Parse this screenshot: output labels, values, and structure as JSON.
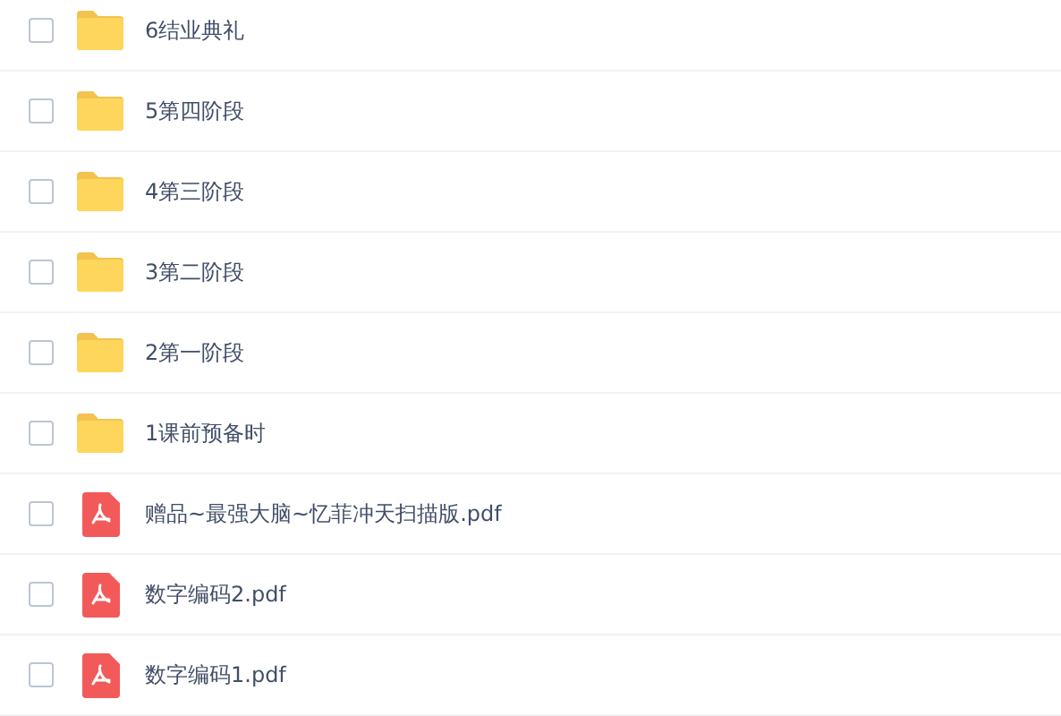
{
  "files": [
    {
      "kind": "folder",
      "name": "6结业典礼",
      "checked": false
    },
    {
      "kind": "folder",
      "name": "5第四阶段",
      "checked": false
    },
    {
      "kind": "folder",
      "name": "4第三阶段",
      "checked": false
    },
    {
      "kind": "folder",
      "name": "3第二阶段",
      "checked": false
    },
    {
      "kind": "folder",
      "name": "2第一阶段",
      "checked": false
    },
    {
      "kind": "folder",
      "name": "1课前预备时",
      "checked": false
    },
    {
      "kind": "pdf",
      "name": "赠品~最强大脑~忆菲冲天扫描版.pdf",
      "checked": false
    },
    {
      "kind": "pdf",
      "name": "数字编码2.pdf",
      "checked": false
    },
    {
      "kind": "pdf",
      "name": "数字编码1.pdf",
      "checked": false
    }
  ]
}
